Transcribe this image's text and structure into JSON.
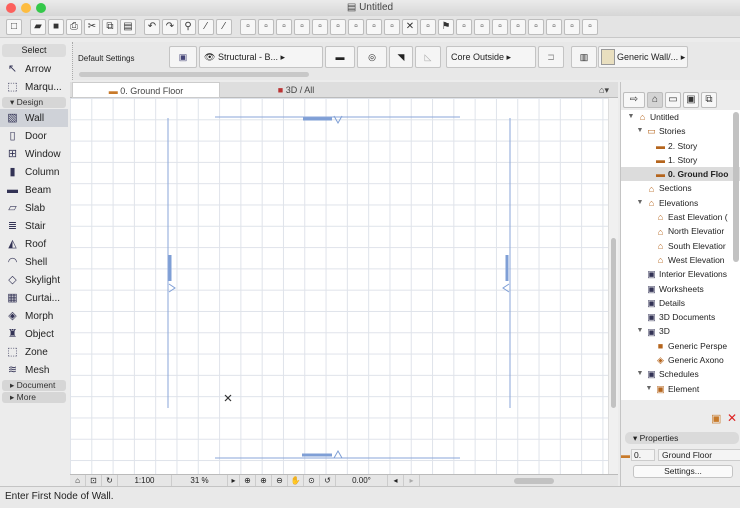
{
  "window": {
    "title": "Untitled"
  },
  "toolbar": {
    "icons": [
      "new-file-icon",
      "open-folder-icon",
      "save-icon",
      "print-icon",
      "cut-icon",
      "copy-icon",
      "paste-icon",
      "undo-icon",
      "redo-icon",
      "find-select-icon",
      "eyedropper-icon",
      "syringe-icon",
      "magic-wand-icon",
      "trim-icon",
      "gravity-icon",
      "grid-snap-icon",
      "guide-icon",
      "cursor-icon",
      "layers-icon",
      "pen-icon",
      "3d-model-icon",
      "close-icon",
      "split-icon",
      "flag-icon",
      "fillet-icon",
      "offset-icon",
      "corner-icon",
      "drag-icon",
      "render-icon",
      "publish-icon",
      "teamwork-icon",
      "settings-icon"
    ]
  },
  "toolbox": {
    "select_label": "Select",
    "select_tools": [
      {
        "label": "Arrow",
        "icon": "arrow-icon"
      },
      {
        "label": "Marqu...",
        "icon": "marquee-icon"
      }
    ],
    "design_label": "Design",
    "design_tools": [
      {
        "label": "Wall",
        "icon": "wall-icon"
      },
      {
        "label": "Door",
        "icon": "door-icon"
      },
      {
        "label": "Window",
        "icon": "window-icon"
      },
      {
        "label": "Column",
        "icon": "column-icon"
      },
      {
        "label": "Beam",
        "icon": "beam-icon"
      },
      {
        "label": "Slab",
        "icon": "slab-icon"
      },
      {
        "label": "Stair",
        "icon": "stair-icon"
      },
      {
        "label": "Roof",
        "icon": "roof-icon"
      },
      {
        "label": "Shell",
        "icon": "shell-icon"
      },
      {
        "label": "Skylight",
        "icon": "skylight-icon"
      },
      {
        "label": "Curtai...",
        "icon": "curtain-wall-icon"
      },
      {
        "label": "Morph",
        "icon": "morph-icon"
      },
      {
        "label": "Object",
        "icon": "object-icon"
      },
      {
        "label": "Zone",
        "icon": "zone-icon"
      },
      {
        "label": "Mesh",
        "icon": "mesh-icon"
      }
    ],
    "document_label": "Document",
    "more_label": "More",
    "selected": "Wall"
  },
  "infobox": {
    "default_settings": "Default Settings",
    "layer": "Structural - B...",
    "structure": "Core Outside",
    "composite": "Generic Wall/..."
  },
  "tabs": [
    {
      "label": "0. Ground Floor",
      "active": true
    },
    {
      "label": "3D / All",
      "active": false
    }
  ],
  "bottombar": {
    "scale": "1:100",
    "zoom": "31 %",
    "angle": "0.00°"
  },
  "status": "Enter First Node of Wall.",
  "navigator": {
    "tree": [
      {
        "label": "Untitled",
        "level": 0,
        "expanded": true,
        "icon": "project-icon"
      },
      {
        "label": "Stories",
        "level": 1,
        "expanded": true,
        "icon": "stories-icon"
      },
      {
        "label": "2. Story",
        "level": 2,
        "icon": "story-icon"
      },
      {
        "label": "1. Story",
        "level": 2,
        "icon": "story-icon"
      },
      {
        "label": "0. Ground Floo",
        "level": 2,
        "icon": "story-icon",
        "selected": true
      },
      {
        "label": "Sections",
        "level": 1,
        "icon": "sections-icon"
      },
      {
        "label": "Elevations",
        "level": 1,
        "expanded": true,
        "icon": "elevations-icon"
      },
      {
        "label": "East Elevation (",
        "level": 2,
        "icon": "elevation-icon"
      },
      {
        "label": "North Elevatior",
        "level": 2,
        "icon": "elevation-icon"
      },
      {
        "label": "South Elevatior",
        "level": 2,
        "icon": "elevation-icon"
      },
      {
        "label": "West Elevation",
        "level": 2,
        "icon": "elevation-icon"
      },
      {
        "label": "Interior Elevations",
        "level": 1,
        "icon": "interior-elevations-icon"
      },
      {
        "label": "Worksheets",
        "level": 1,
        "icon": "worksheets-icon"
      },
      {
        "label": "Details",
        "level": 1,
        "icon": "details-icon"
      },
      {
        "label": "3D Documents",
        "level": 1,
        "icon": "3d-documents-icon"
      },
      {
        "label": "3D",
        "level": 1,
        "expanded": true,
        "icon": "3d-icon"
      },
      {
        "label": "Generic Perspe",
        "level": 2,
        "icon": "camera-icon"
      },
      {
        "label": "Generic Axono",
        "level": 2,
        "icon": "axonometry-icon"
      },
      {
        "label": "Schedules",
        "level": 1,
        "expanded": true,
        "icon": "schedules-icon"
      },
      {
        "label": "Element",
        "level": 2,
        "expanded": true,
        "icon": "element-icon"
      }
    ],
    "properties_label": "Properties",
    "story_number": "0.",
    "story_name": "Ground Floor",
    "settings_label": "Settings..."
  }
}
